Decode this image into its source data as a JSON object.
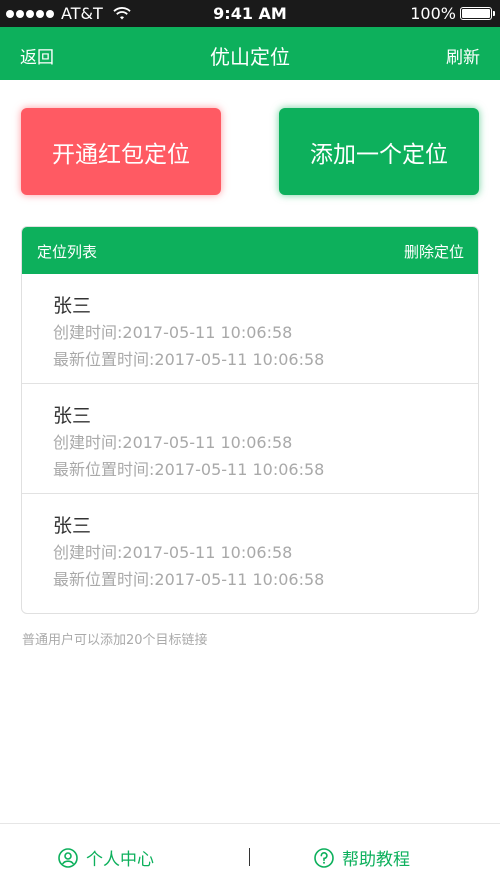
{
  "status_bar": {
    "carrier": "AT&T",
    "time": "9:41 AM",
    "battery": "100%",
    "battery_level": 1.0
  },
  "nav": {
    "back": "返回",
    "title": "优山定位",
    "refresh": "刷新"
  },
  "actions": {
    "open_red_packet": "开通红包定位",
    "add_location": "添加一个定位"
  },
  "list": {
    "title": "定位列表",
    "delete": "删除定位",
    "items": [
      {
        "name": "张三",
        "created": "创建时间:2017-05-11 10:06:58",
        "updated": "最新位置时间:2017-05-11 10:06:58"
      },
      {
        "name": "张三",
        "created": "创建时间:2017-05-11 10:06:58",
        "updated": "最新位置时间:2017-05-11 10:06:58"
      },
      {
        "name": "张三",
        "created": "创建时间:2017-05-11 10:06:58",
        "updated": "最新位置时间:2017-05-11 10:06:58"
      }
    ]
  },
  "footnote": "普通用户可以添加20个目标链接",
  "tabs": {
    "personal": "个人中心",
    "help": "帮助教程",
    "divider": "|"
  },
  "colors": {
    "primary": "#0db05c",
    "danger": "#ff5a63",
    "status_bar": "#1a1a1a"
  },
  "icons": {
    "personal": "user-circle-icon",
    "help": "question-circle-icon",
    "wifi": "wifi-icon",
    "battery": "battery-icon"
  }
}
